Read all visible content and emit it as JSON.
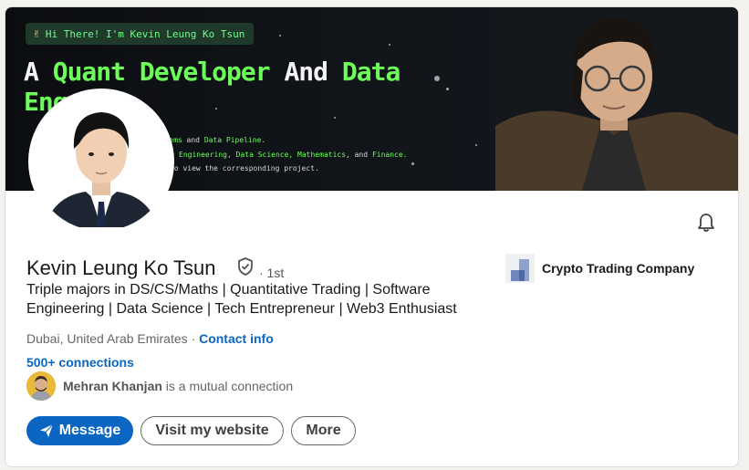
{
  "banner": {
    "greeting": "Hi There! I'm Kevin Leung Ko Tsun",
    "headline_part1": "A ",
    "headline_part2": "Quant Developer",
    "headline_part3": " And ",
    "headline_part4": "Data",
    "headline_line2": "Eng",
    "line1_a": "systems",
    "line1_b": " and ",
    "line1_c": "Data Pipeline.",
    "line2_a": "Engineering, Data Science, Mathematics,",
    "line2_b": " and ",
    "line2_c": "Finance.",
    "line3": "to view the corresponding project."
  },
  "profile": {
    "name": "Kevin Leung Ko Tsun",
    "degree": "· 1st",
    "headline": "Triple majors in DS/CS/Maths | Quantitative Trading | Software Engineering | Data Science | Tech Entrepreneur | Web3 Enthusiast",
    "location": "Dubai, United Arab Emirates · ",
    "contact_label": "Contact info",
    "connections": "500+ connections",
    "mutual_name": "Mehran Khanjan",
    "mutual_suffix": " is a mutual connection"
  },
  "company": {
    "name": "Crypto Trading Company"
  },
  "actions": {
    "message": "Message",
    "website": "Visit my website",
    "more": "More"
  },
  "colors": {
    "accent": "#0a66c2",
    "banner_green": "#6cff5a",
    "banner_bg": "#0b0d10"
  },
  "icons": {
    "bell": "bell-icon",
    "verify": "verified-shield-icon",
    "send": "send-icon"
  }
}
